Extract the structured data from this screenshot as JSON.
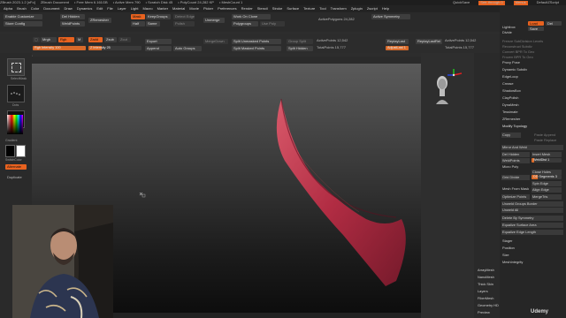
{
  "titlebar": {
    "items": [
      "ZBrush 2023.1.2 [nFo]",
      "ZBrush Document",
      "• Free Mem 6.161GB",
      "• Active Mem 790",
      "• Scratch Disk 45",
      "• PolyCount 24,282 KP",
      "• MeshCount 1"
    ],
    "quicksave": "QuickSave",
    "seethrough": "See-through 0",
    "menus": "Menus",
    "defaultscript": "DefaultZScript"
  },
  "menubar": [
    "Alpha",
    "Brush",
    "Color",
    "Document",
    "Draw",
    "Dynamics",
    "Edit",
    "File",
    "Layer",
    "Light",
    "Macro",
    "Marker",
    "Material",
    "Movie",
    "Picker",
    "Preferences",
    "Render",
    "Stencil",
    "Stroke",
    "Surface",
    "Texture",
    "Tool",
    "Transform",
    "Zplugin",
    "Zscript",
    "Help"
  ],
  "toolbar1": {
    "enable_customize": "Enable Customize",
    "save_config": "Store Config",
    "del_hidden": "Del Hidden",
    "weld_points": "WeldPoints",
    "zremesher": "ZRemesher",
    "mask": "Mask",
    "keep_groups": "KeepGroups",
    "half": "Half",
    "same": "Same",
    "detect_edges": "Detect Edges",
    "polish": "Polish",
    "uvmorph": "UV Morph",
    "unmerge": "Unmerge",
    "work_on_clone": "Work On Clone",
    "polygroups": "Polygroups",
    "use_poly": "Use Poly",
    "active_symmetry": "Active Symmetry",
    "active_polygons": "ActivePolygons 24,282",
    "bevel": "Bevel Adjust"
  },
  "toolbar2": {
    "mrgb": "Mrgb",
    "rgb": "Rgb",
    "m": "M",
    "zadd": "Zadd",
    "zsub": "Zsub",
    "zcut": "Zcut",
    "rgb_intensity": "Rgb Intensity 100",
    "z_intensity": "Z Intensity 25",
    "export": "Export",
    "append": "Append",
    "auto_groups": "Auto Groups",
    "merge_down": "MergeDown",
    "split_unmasked": "Split Unmasked Points",
    "split_masked": "Split Masked Points",
    "group_split": "Group Split",
    "split_hidden": "Split Hidden",
    "active_points": "ActivePoints 12,542",
    "total_points": "TotalPoints 15,777",
    "adjust_last": "AdjustLast 1",
    "replay_last": "ReplayLast",
    "replay_last_rel": "ReplayLastRel",
    "active_points2": "ActivePoints 12,542",
    "total_points2": "TotalPoints 15,777"
  },
  "toolbar3": {
    "focal": "0.631,-0.428,-0.54"
  },
  "leftshelf": {
    "select_mask": "SelectMask",
    "dots": "Dots",
    "gradient": "Gradient",
    "switch_color": "SwitchColor",
    "alternate": "Alternate",
    "duplicate": "Duplicate"
  },
  "rightpanel": {
    "menus_top": [
      "Lightbox",
      "Clone",
      "Divide",
      "Make PolyMesh3D",
      "Ready Clone",
      "Rename",
      "Fitness Tools",
      "Tool",
      "Double",
      "Close",
      "Undo",
      "Ready Sym"
    ],
    "topright_buttons": [
      "Load",
      "Save",
      "Del"
    ],
    "list": [
      "Freeze SubDivision Levels",
      "Reconstruct Subdiv",
      "Convert BPR To Geo",
      "Frozen BPR To Geo",
      "Proxy Pose",
      "Dynamic Subdiv",
      "EdgeLoop",
      "Crease",
      "ShadowBox",
      "ClayPolish",
      "DynaMesh",
      "Tessimate",
      "ZRemesher",
      "Modify Topology",
      "Copy",
      "Mirror And Weld",
      "Del Hidden",
      "WeldPoints",
      "Micro Poly",
      "Grid Divide",
      "Mesh From Mask",
      "Optimize Points",
      "Unweld Groups Border",
      "Unweld All",
      "Delete By Symmetry",
      "Equalize Surface Area",
      "Equalize Edge Length",
      "Stager",
      "Position",
      "Size",
      "MeshIntegrity",
      "ArrayMesh",
      "NanoMesh",
      "Thick Skin",
      "Layers",
      "FiberMesh",
      "Geometry HD",
      "Preview"
    ],
    "right_col": [
      "Paste Append",
      "Paste Replace",
      "Insert Mesh",
      "WeldDist 1",
      "Close Holes",
      "Spin Edge",
      "Align Edge",
      "MergeTris",
      "DD Segments 3"
    ]
  },
  "rightstrip": {
    "slots": [
      "Stroke",
      "Dots",
      "Transp",
      "Persp",
      "Floor",
      "Local",
      "Frame",
      "Move",
      "Zoom",
      "Rotate"
    ]
  },
  "colors": {
    "accent": "#e8621f",
    "panel": "#2d2d2d",
    "mesh": "#c8324a"
  },
  "watermark": "Udemy"
}
